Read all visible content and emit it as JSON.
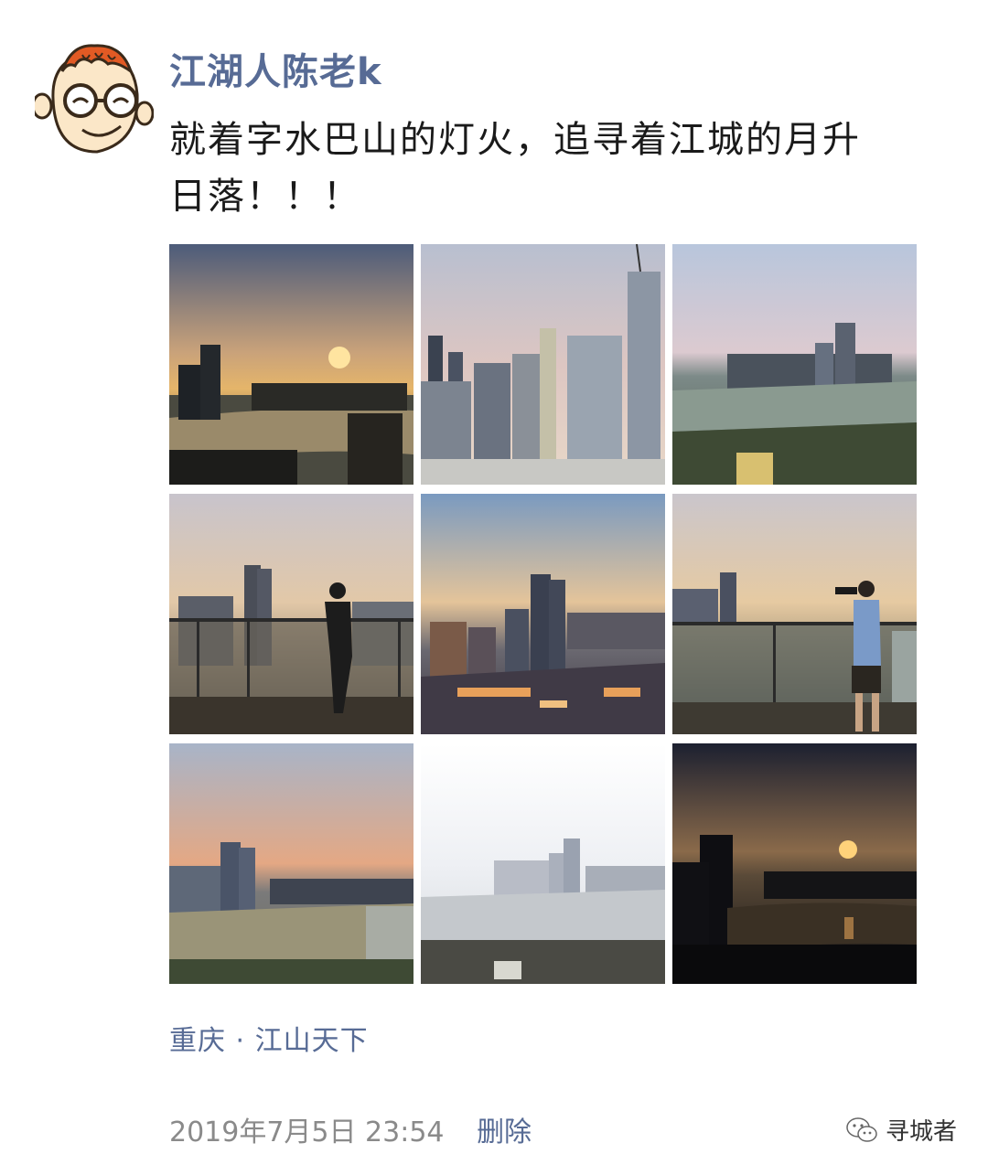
{
  "post": {
    "username": "江湖人陈老k",
    "text_line_1": "就着字水巴山的灯火，追寻着江城的月升",
    "text_line_2": "日落！！！",
    "location": "重庆 · 江山天下",
    "timestamp": "2019年7月5日 23:54",
    "delete_label": "删除"
  },
  "photos": [
    {
      "name": "photo-sunset-skyline-river",
      "icon": "photo"
    },
    {
      "name": "photo-towers-under-construction",
      "icon": "photo"
    },
    {
      "name": "photo-river-panorama",
      "icon": "photo"
    },
    {
      "name": "photo-man-on-balcony",
      "icon": "photo"
    },
    {
      "name": "photo-raffles-city-dusk",
      "icon": "photo"
    },
    {
      "name": "photo-photographer-on-balcony",
      "icon": "photo"
    },
    {
      "name": "photo-dusk-skyline-highrise",
      "icon": "photo"
    },
    {
      "name": "photo-bright-river-panorama",
      "icon": "photo"
    },
    {
      "name": "photo-dark-sunset-silhouette",
      "icon": "photo"
    }
  ],
  "watermark": {
    "label": "寻城者",
    "icon": "wechat-icon"
  },
  "colors": {
    "link": "#576b95",
    "text": "#1a1a1a",
    "meta": "#8a8a8a"
  }
}
